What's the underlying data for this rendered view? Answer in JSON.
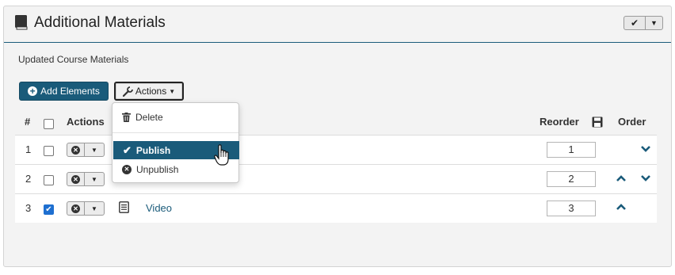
{
  "panel": {
    "title": "Additional Materials",
    "subtitle": "Updated Course Materials"
  },
  "toolbar": {
    "add_label": "Add Elements",
    "actions_label": "Actions"
  },
  "table": {
    "headers": {
      "num": "#",
      "actions": "Actions",
      "reorder": "Reorder",
      "order": "Order"
    },
    "rows": [
      {
        "num": "1",
        "checked": false,
        "title": "",
        "order_value": "1",
        "up": false,
        "down": true
      },
      {
        "num": "2",
        "checked": false,
        "title": "",
        "order_value": "2",
        "up": true,
        "down": true
      },
      {
        "num": "3",
        "checked": true,
        "title": "Video",
        "order_value": "3",
        "up": true,
        "down": false
      }
    ]
  },
  "menu": {
    "items": [
      {
        "label": "Delete",
        "icon": "trash-icon"
      },
      {
        "label": "Publish",
        "icon": "check-icon",
        "active": true
      },
      {
        "label": "Unpublish",
        "icon": "circle-x-icon"
      }
    ]
  },
  "colors": {
    "accent": "#1a5b7a",
    "checkbox_on": "#1e6fd0",
    "panel_bg": "#f3f3f3"
  }
}
